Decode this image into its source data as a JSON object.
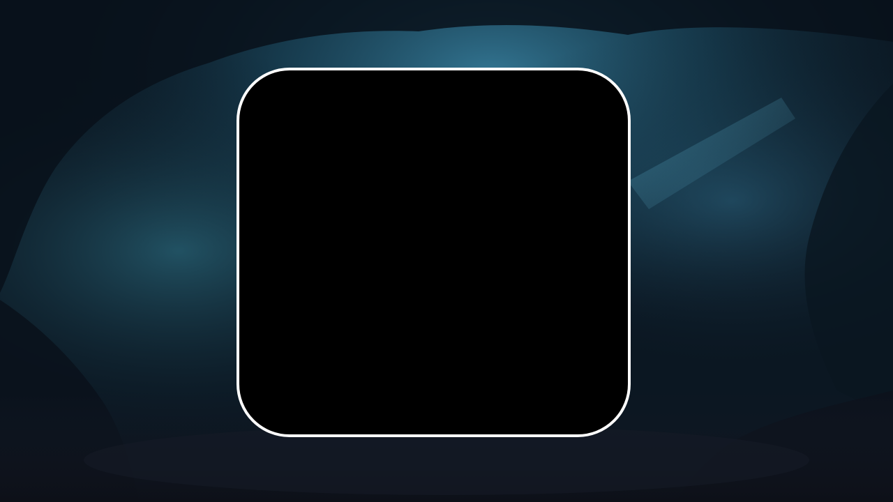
{
  "scene": {
    "background": "cave-background",
    "panel": {
      "fill_color": "#000000",
      "border_color": "#ffffff"
    }
  },
  "colors": {
    "cave_dark": "#0a1520",
    "cave_teal": "#1e4a5c",
    "cave_glow": "#2f6f8a",
    "floor": "#121620"
  }
}
